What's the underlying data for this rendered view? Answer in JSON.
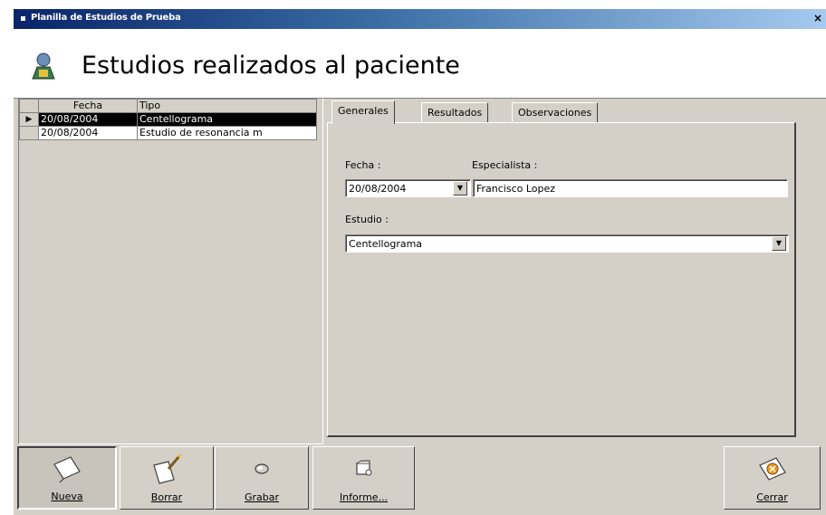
{
  "window": {
    "title": "Planilla de Estudios de Prueba",
    "close_glyph": "×"
  },
  "header": {
    "title": "Estudios realizados al paciente",
    "icon": "patient-icon"
  },
  "grid": {
    "columns": [
      "Fecha",
      "Tipo"
    ],
    "rows": [
      {
        "fecha": "20/08/2004",
        "tipo": "Centellograma",
        "selected": true
      },
      {
        "fecha": "20/08/2004",
        "tipo": "Estudio de resonancia m",
        "selected": false
      }
    ],
    "indicator_glyph": "▶"
  },
  "tabs": [
    {
      "label": "Generales",
      "active": true
    },
    {
      "label": "Resultados",
      "active": false
    },
    {
      "label": "Observaciones",
      "active": false
    }
  ],
  "form": {
    "fecha_label": "Fecha :",
    "fecha_value": "20/08/2004",
    "especialista_label": "Especialista :",
    "especialista_value": "Francisco Lopez",
    "estudio_label": "Estudio :",
    "estudio_value": "Centellograma",
    "dropdown_glyph": "▼"
  },
  "toolbar": {
    "nueva": "Nueva",
    "borrar": "Borrar",
    "grabar": "Grabar",
    "informe": "Informe...",
    "cerrar": "Cerrar"
  }
}
